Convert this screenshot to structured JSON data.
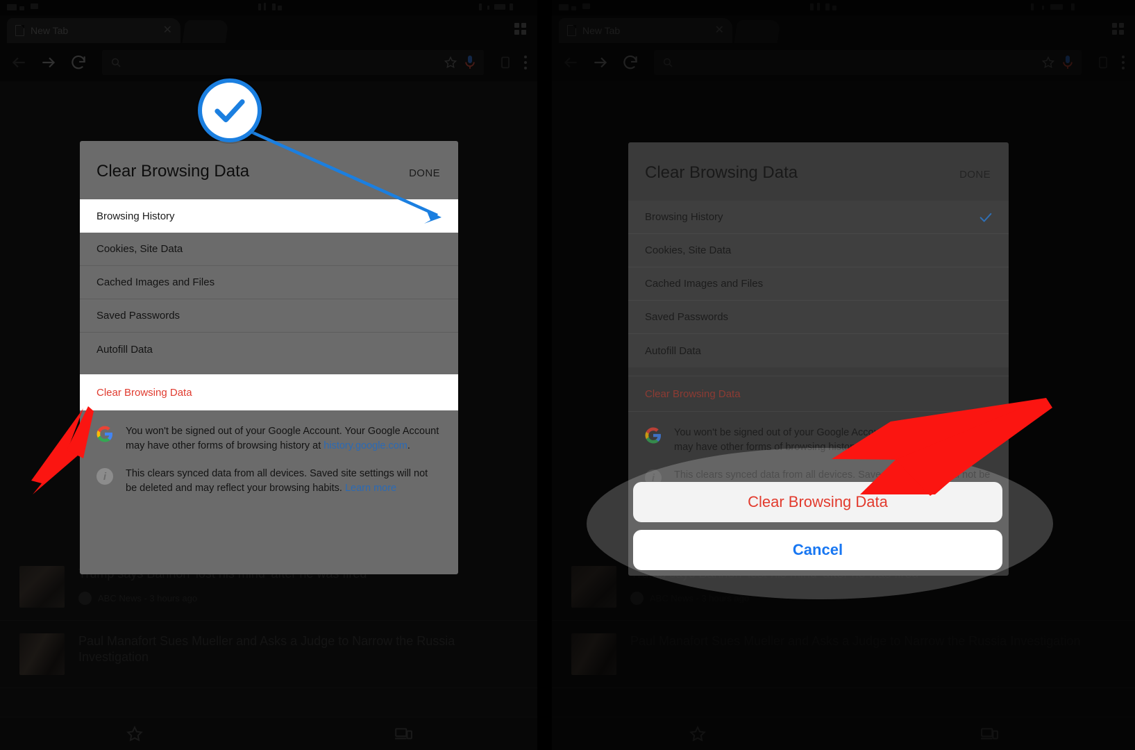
{
  "browser": {
    "tab": {
      "title": "New Tab",
      "close_icon": "close-icon",
      "favicon": "page-icon"
    },
    "tab_switcher_icon": "grid-icon",
    "toolbar": {
      "back_icon": "arrow-back-icon",
      "forward_icon": "arrow-forward-icon",
      "reload_icon": "reload-icon",
      "omnibox_placeholder": "",
      "search_icon": "search-icon",
      "bookmark_icon": "star-icon",
      "voice_icon": "microphone-icon",
      "share_icon": "share-icon",
      "menu_icon": "three-dots-icon"
    },
    "bottom_bar": {
      "bookmarks_icon": "star-icon",
      "recent_tabs_icon": "devices-icon"
    }
  },
  "news": [
    {
      "title": "Trump says Bannon 'lost his mind' after he was fired",
      "source": "ABC News",
      "time": "3 hours ago",
      "meta": "ABC News - 3 hours ago"
    },
    {
      "title": "Paul Manafort Sues Mueller and Asks a Judge to Narrow the Russia Investigation",
      "source": "",
      "time": "",
      "meta": ""
    }
  ],
  "dialog": {
    "title": "Clear Browsing Data",
    "done_label": "DONE",
    "options": [
      {
        "label": "Browsing History",
        "selected": true,
        "checked": true
      },
      {
        "label": "Cookies, Site Data",
        "selected": false,
        "checked": false
      },
      {
        "label": "Cached Images and Files",
        "selected": false,
        "checked": false
      },
      {
        "label": "Saved Passwords",
        "selected": false,
        "checked": false
      },
      {
        "label": "Autofill Data",
        "selected": false,
        "checked": false
      }
    ],
    "action_label": "Clear Browsing Data",
    "notes": [
      {
        "icon": "google-g-icon",
        "text_before": "You won't be signed out of your Google Account. Your Google Account may have other forms of browsing history at ",
        "link": "history.google.com",
        "text_after": "."
      },
      {
        "icon": "info-icon",
        "text_before": "This clears synced data from all devices. Saved site settings will not be deleted and may reflect your browsing habits. ",
        "link": "Learn more",
        "text_after": ""
      }
    ]
  },
  "action_sheet": {
    "destructive_label": "Clear Browsing Data",
    "cancel_label": "Cancel"
  },
  "annotations": {
    "check_badge_icon": "checkmark-icon",
    "pointer_line_color": "#1b7fe0",
    "arrow_color": "#fb1511",
    "highlight_shape": "ellipse"
  },
  "colors": {
    "accent_blue": "#1b7fe0",
    "destructive_red": "#e23b2e",
    "cancel_blue": "#1877f2",
    "annotation_red": "#fb1511",
    "link_blue": "#2b6ab5"
  }
}
